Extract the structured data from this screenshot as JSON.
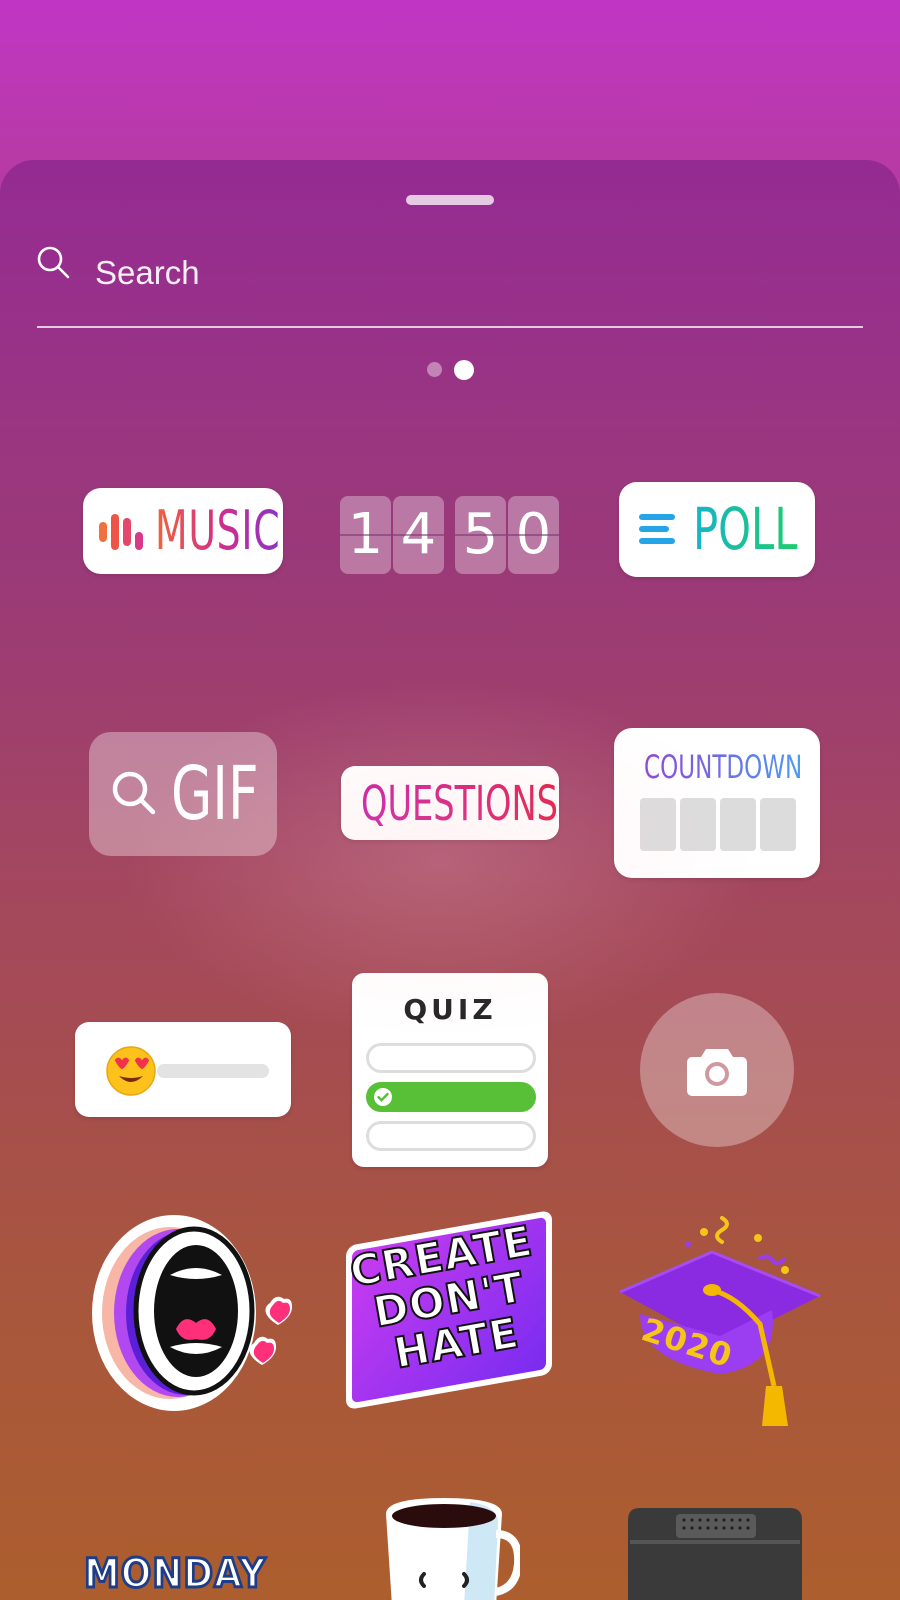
{
  "search": {
    "placeholder": "Search",
    "value": ""
  },
  "pager": {
    "count": 2,
    "active": 2
  },
  "stickers": {
    "music": {
      "label": "MUSIC"
    },
    "time": {
      "digits": [
        "1",
        "4",
        "5",
        "0"
      ]
    },
    "poll": {
      "label": "POLL"
    },
    "gif": {
      "label": "GIF"
    },
    "questions": {
      "label": "QUESTIONS"
    },
    "countdown": {
      "label": "COUNTDOWN"
    },
    "emoji_slider": {
      "emoji": "😍"
    },
    "quiz": {
      "label": "QUIZ"
    },
    "create": {
      "lines": [
        "CREATE",
        "DON'T",
        "HATE"
      ]
    },
    "grad": {
      "year": "2020"
    },
    "monday": {
      "label": "MONDAY"
    }
  },
  "colors": {
    "bg_top": "#c036c4",
    "bg_bottom": "#b0622e",
    "quiz_correct": "#58c036",
    "poll_accent": "#1fcc6a"
  }
}
